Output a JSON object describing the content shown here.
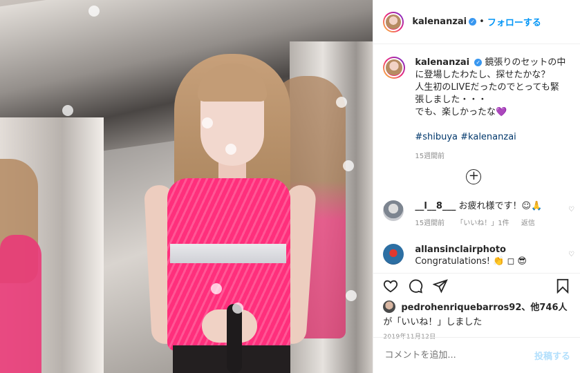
{
  "header": {
    "username": "kalenanzai",
    "verified_badge": "✓",
    "separator": "•",
    "follow_label": "フォローする"
  },
  "caption": {
    "username": "kalenanzai",
    "text_line1": "鏡張りのセットの中に登場したわたし、探せたかな？",
    "text_line2": "人生初のLIVEだったのでとっても緊張しました・・・",
    "text_line3": "でも、楽しかったな💜",
    "hashtags": "#shibuya #kalenanzai",
    "time": "15週間前"
  },
  "load_more_icon": "plus-circle-icon",
  "comments": [
    {
      "username": "__l__8___",
      "text": "お疲れ様です！☺🙏",
      "time": "15週間前",
      "likes": "「いいね！」1件",
      "reply": "返信"
    },
    {
      "username": "allansinclairphoto",
      "text": "Congratulations! 👏 ◻ 😎"
    }
  ],
  "actions": {
    "like_icon": "heart-icon",
    "comment_icon": "comment-icon",
    "share_icon": "share-icon",
    "save_icon": "bookmark-icon"
  },
  "likes": {
    "line1": "pedrohenriquebarros92、他746人",
    "line2": "が「いいね！」しました"
  },
  "date": "2019年11月12日",
  "comment_box": {
    "placeholder": "コメントを追加...",
    "post_label": "投稿する"
  },
  "colors": {
    "accent": "#0095f6",
    "post_disabled": "#b2dffc",
    "text": "#262626",
    "muted": "#8e8e8e"
  }
}
